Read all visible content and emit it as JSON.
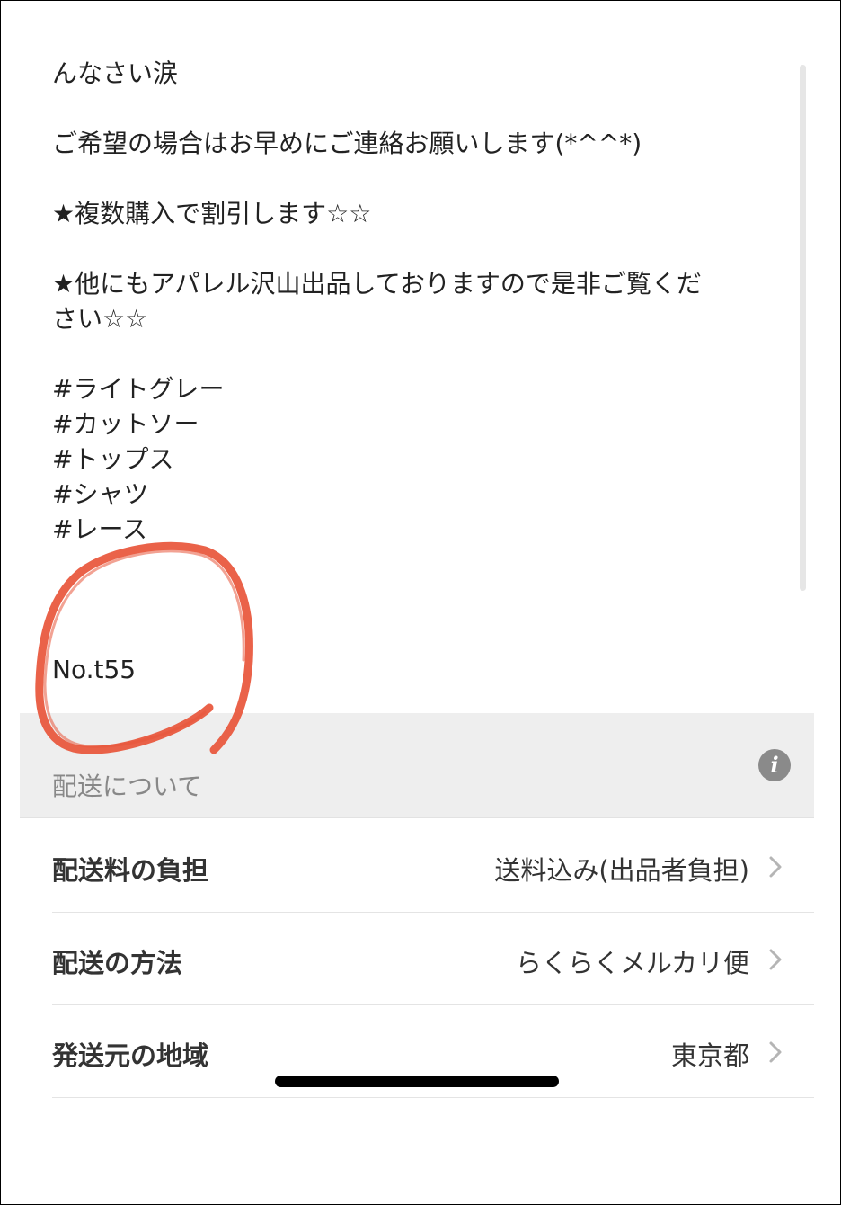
{
  "description": {
    "lines": [
      "んなさい涙",
      "ご希望の場合はお早めにご連絡お願いします(*^^*)",
      "★複数購入で割引します☆☆",
      "★他にもアパレル沢山出品しておりますので是非ご覧くだ",
      "さい☆☆",
      "#ライトグレー",
      "#カットソー",
      "#トップス",
      "#シャツ",
      "#レース",
      "No.t55"
    ]
  },
  "shipping_section": {
    "title": "配送について",
    "info_icon": "info-icon",
    "rows": [
      {
        "label": "配送料の負担",
        "value": "送料込み(出品者負担)"
      },
      {
        "label": "配送の方法",
        "value": "らくらくメルカリ便"
      },
      {
        "label": "発送元の地域",
        "value": "東京都"
      }
    ]
  },
  "colors": {
    "annotation_circle": "#e8553a",
    "section_bg": "#eeeeee",
    "info_icon_bg": "#8a8a8a"
  }
}
